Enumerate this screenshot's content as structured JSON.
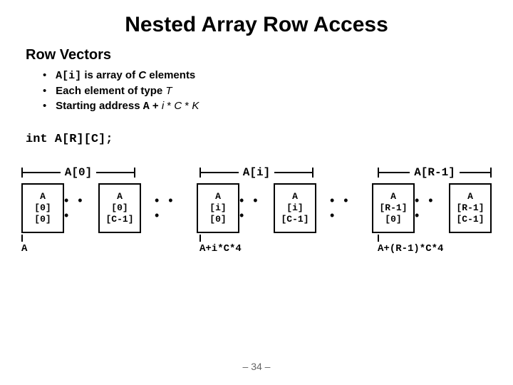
{
  "title": "Nested Array Row Access",
  "subtitle": "Row Vectors",
  "bullets": {
    "b1_pre": "",
    "b1_code": "A[i]",
    "b1_mid": " is array of ",
    "b1_c": "C",
    "b1_post": " elements",
    "b2_pre": "Each element of type ",
    "b2_t": "T",
    "b3_pre": "Starting address ",
    "b3_code": "A",
    "b3_mid": "  +   ",
    "b3_i": "i",
    "b3_star1": " * ",
    "b3_c": "C",
    "b3_star2": " * ",
    "b3_k": "K"
  },
  "decl": "int A[R][C];",
  "labels": {
    "l0": "A[0]",
    "l1": "A[i]",
    "l2": "A[R-1]"
  },
  "cells": {
    "c00": "A\n[0]\n[0]",
    "c01": "A\n[0]\n[C-1]",
    "c10": "A\n[i]\n[0]",
    "c11": "A\n[i]\n[C-1]",
    "c20": "A\n[R-1]\n[0]",
    "c21": "A\n[R-1]\n[C-1]"
  },
  "dots": "•  •  •",
  "addrs": {
    "a0": "A",
    "a1": "A+i*C*4",
    "a2": "A+(R-1)*C*4"
  },
  "pagenum": "– 34 –"
}
